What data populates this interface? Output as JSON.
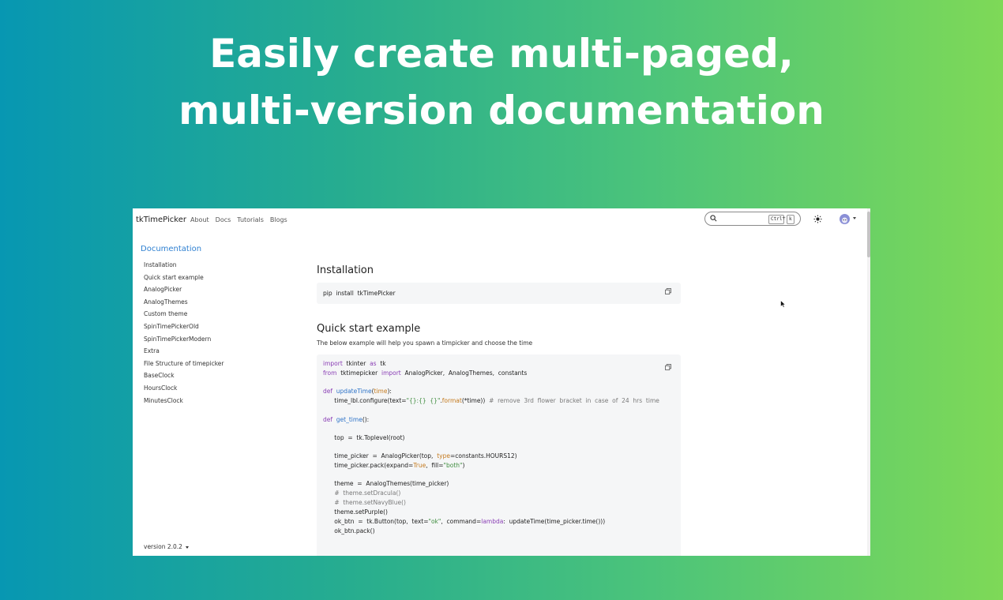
{
  "headline": {
    "line1": "Easily create multi-paged,",
    "line2": "multi-version documentation"
  },
  "navbar": {
    "brand": "tkTimePicker",
    "links": [
      "About",
      "Docs",
      "Tutorials",
      "Blogs"
    ],
    "search": {
      "placeholder": "",
      "shortcut_key1": "Ctrl",
      "shortcut_plus": "+",
      "shortcut_key2": "k"
    },
    "icons": {
      "search": "search-icon",
      "theme": "sun-icon",
      "avatar": "avatar-icon"
    }
  },
  "sidebar": {
    "title": "Documentation",
    "items": [
      "Installation",
      "Quick start example",
      "AnalogPicker",
      "AnalogThemes",
      "Custom theme",
      "SpinTimePickerOld",
      "SpinTimePickerModern",
      "Extra",
      "File Structure of timepicker",
      "BaseClock",
      "HoursClock",
      "MinutesClock"
    ],
    "version": "version 2.0.2"
  },
  "main": {
    "installation": {
      "heading": "Installation",
      "code": "pip  install  tkTimePicker"
    },
    "quick_start": {
      "heading": "Quick start example",
      "description": "The below example will help you spawn a timpicker and choose the time"
    }
  },
  "colors": {
    "gradient_start": "#0797b2",
    "gradient_end": "#7ed957",
    "link_blue": "#2f80d1",
    "code_bg": "#f5f6f7"
  }
}
